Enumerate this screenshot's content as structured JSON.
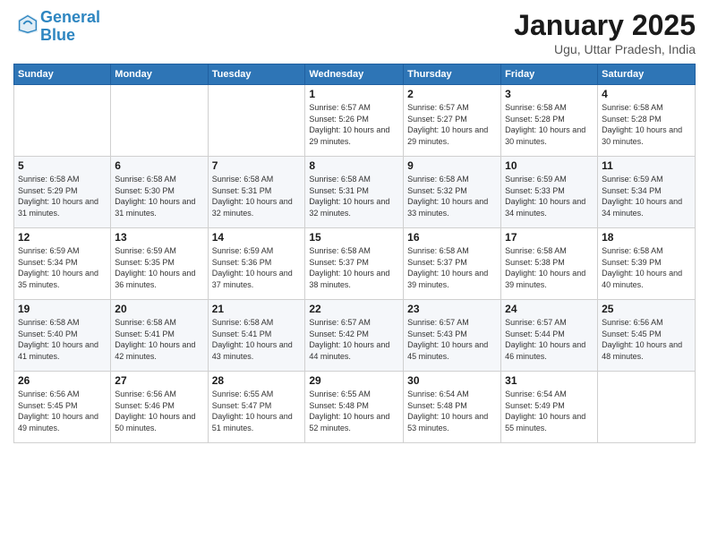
{
  "logo": {
    "line1": "General",
    "line2": "Blue"
  },
  "header": {
    "month": "January 2025",
    "location": "Ugu, Uttar Pradesh, India"
  },
  "weekdays": [
    "Sunday",
    "Monday",
    "Tuesday",
    "Wednesday",
    "Thursday",
    "Friday",
    "Saturday"
  ],
  "weeks": [
    [
      {
        "day": "",
        "sunrise": "",
        "sunset": "",
        "daylight": ""
      },
      {
        "day": "",
        "sunrise": "",
        "sunset": "",
        "daylight": ""
      },
      {
        "day": "",
        "sunrise": "",
        "sunset": "",
        "daylight": ""
      },
      {
        "day": "1",
        "sunrise": "Sunrise: 6:57 AM",
        "sunset": "Sunset: 5:26 PM",
        "daylight": "Daylight: 10 hours and 29 minutes."
      },
      {
        "day": "2",
        "sunrise": "Sunrise: 6:57 AM",
        "sunset": "Sunset: 5:27 PM",
        "daylight": "Daylight: 10 hours and 29 minutes."
      },
      {
        "day": "3",
        "sunrise": "Sunrise: 6:58 AM",
        "sunset": "Sunset: 5:28 PM",
        "daylight": "Daylight: 10 hours and 30 minutes."
      },
      {
        "day": "4",
        "sunrise": "Sunrise: 6:58 AM",
        "sunset": "Sunset: 5:28 PM",
        "daylight": "Daylight: 10 hours and 30 minutes."
      }
    ],
    [
      {
        "day": "5",
        "sunrise": "Sunrise: 6:58 AM",
        "sunset": "Sunset: 5:29 PM",
        "daylight": "Daylight: 10 hours and 31 minutes."
      },
      {
        "day": "6",
        "sunrise": "Sunrise: 6:58 AM",
        "sunset": "Sunset: 5:30 PM",
        "daylight": "Daylight: 10 hours and 31 minutes."
      },
      {
        "day": "7",
        "sunrise": "Sunrise: 6:58 AM",
        "sunset": "Sunset: 5:31 PM",
        "daylight": "Daylight: 10 hours and 32 minutes."
      },
      {
        "day": "8",
        "sunrise": "Sunrise: 6:58 AM",
        "sunset": "Sunset: 5:31 PM",
        "daylight": "Daylight: 10 hours and 32 minutes."
      },
      {
        "day": "9",
        "sunrise": "Sunrise: 6:58 AM",
        "sunset": "Sunset: 5:32 PM",
        "daylight": "Daylight: 10 hours and 33 minutes."
      },
      {
        "day": "10",
        "sunrise": "Sunrise: 6:59 AM",
        "sunset": "Sunset: 5:33 PM",
        "daylight": "Daylight: 10 hours and 34 minutes."
      },
      {
        "day": "11",
        "sunrise": "Sunrise: 6:59 AM",
        "sunset": "Sunset: 5:34 PM",
        "daylight": "Daylight: 10 hours and 34 minutes."
      }
    ],
    [
      {
        "day": "12",
        "sunrise": "Sunrise: 6:59 AM",
        "sunset": "Sunset: 5:34 PM",
        "daylight": "Daylight: 10 hours and 35 minutes."
      },
      {
        "day": "13",
        "sunrise": "Sunrise: 6:59 AM",
        "sunset": "Sunset: 5:35 PM",
        "daylight": "Daylight: 10 hours and 36 minutes."
      },
      {
        "day": "14",
        "sunrise": "Sunrise: 6:59 AM",
        "sunset": "Sunset: 5:36 PM",
        "daylight": "Daylight: 10 hours and 37 minutes."
      },
      {
        "day": "15",
        "sunrise": "Sunrise: 6:58 AM",
        "sunset": "Sunset: 5:37 PM",
        "daylight": "Daylight: 10 hours and 38 minutes."
      },
      {
        "day": "16",
        "sunrise": "Sunrise: 6:58 AM",
        "sunset": "Sunset: 5:37 PM",
        "daylight": "Daylight: 10 hours and 39 minutes."
      },
      {
        "day": "17",
        "sunrise": "Sunrise: 6:58 AM",
        "sunset": "Sunset: 5:38 PM",
        "daylight": "Daylight: 10 hours and 39 minutes."
      },
      {
        "day": "18",
        "sunrise": "Sunrise: 6:58 AM",
        "sunset": "Sunset: 5:39 PM",
        "daylight": "Daylight: 10 hours and 40 minutes."
      }
    ],
    [
      {
        "day": "19",
        "sunrise": "Sunrise: 6:58 AM",
        "sunset": "Sunset: 5:40 PM",
        "daylight": "Daylight: 10 hours and 41 minutes."
      },
      {
        "day": "20",
        "sunrise": "Sunrise: 6:58 AM",
        "sunset": "Sunset: 5:41 PM",
        "daylight": "Daylight: 10 hours and 42 minutes."
      },
      {
        "day": "21",
        "sunrise": "Sunrise: 6:58 AM",
        "sunset": "Sunset: 5:41 PM",
        "daylight": "Daylight: 10 hours and 43 minutes."
      },
      {
        "day": "22",
        "sunrise": "Sunrise: 6:57 AM",
        "sunset": "Sunset: 5:42 PM",
        "daylight": "Daylight: 10 hours and 44 minutes."
      },
      {
        "day": "23",
        "sunrise": "Sunrise: 6:57 AM",
        "sunset": "Sunset: 5:43 PM",
        "daylight": "Daylight: 10 hours and 45 minutes."
      },
      {
        "day": "24",
        "sunrise": "Sunrise: 6:57 AM",
        "sunset": "Sunset: 5:44 PM",
        "daylight": "Daylight: 10 hours and 46 minutes."
      },
      {
        "day": "25",
        "sunrise": "Sunrise: 6:56 AM",
        "sunset": "Sunset: 5:45 PM",
        "daylight": "Daylight: 10 hours and 48 minutes."
      }
    ],
    [
      {
        "day": "26",
        "sunrise": "Sunrise: 6:56 AM",
        "sunset": "Sunset: 5:45 PM",
        "daylight": "Daylight: 10 hours and 49 minutes."
      },
      {
        "day": "27",
        "sunrise": "Sunrise: 6:56 AM",
        "sunset": "Sunset: 5:46 PM",
        "daylight": "Daylight: 10 hours and 50 minutes."
      },
      {
        "day": "28",
        "sunrise": "Sunrise: 6:55 AM",
        "sunset": "Sunset: 5:47 PM",
        "daylight": "Daylight: 10 hours and 51 minutes."
      },
      {
        "day": "29",
        "sunrise": "Sunrise: 6:55 AM",
        "sunset": "Sunset: 5:48 PM",
        "daylight": "Daylight: 10 hours and 52 minutes."
      },
      {
        "day": "30",
        "sunrise": "Sunrise: 6:54 AM",
        "sunset": "Sunset: 5:48 PM",
        "daylight": "Daylight: 10 hours and 53 minutes."
      },
      {
        "day": "31",
        "sunrise": "Sunrise: 6:54 AM",
        "sunset": "Sunset: 5:49 PM",
        "daylight": "Daylight: 10 hours and 55 minutes."
      },
      {
        "day": "",
        "sunrise": "",
        "sunset": "",
        "daylight": ""
      }
    ]
  ]
}
